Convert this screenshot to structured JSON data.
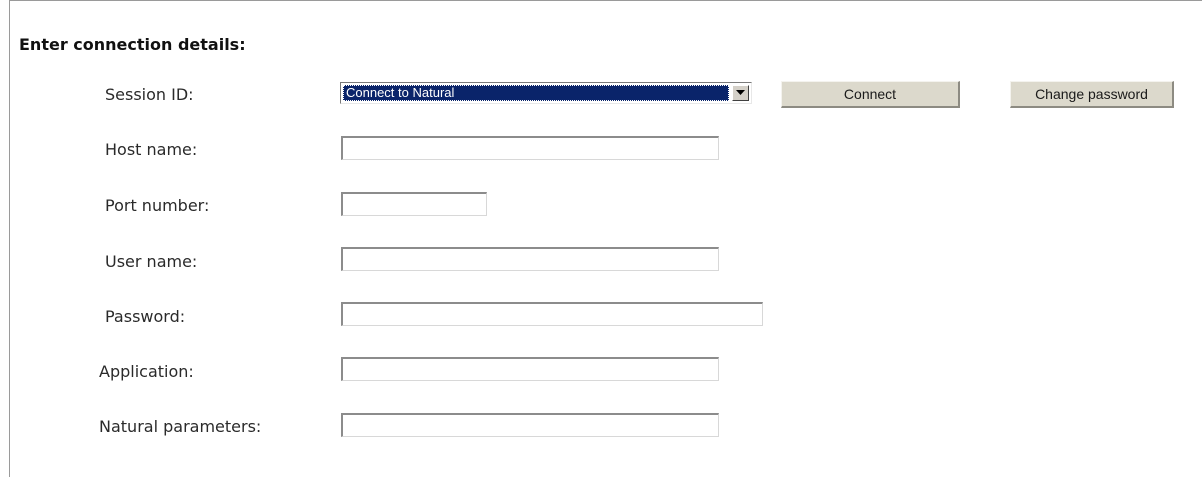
{
  "form": {
    "heading": "Enter connection details:",
    "session": {
      "label": "Session ID:",
      "selected": "Connect to Natural"
    },
    "buttons": {
      "connect": "Connect",
      "change_password": "Change password"
    },
    "fields": {
      "host_name": {
        "label": "Host name:",
        "value": ""
      },
      "port_number": {
        "label": "Port number:",
        "value": ""
      },
      "user_name": {
        "label": "User name:",
        "value": ""
      },
      "password": {
        "label": "Password:",
        "value": ""
      },
      "application": {
        "label": "Application:",
        "value": ""
      },
      "natural_parameters": {
        "label": "Natural parameters:",
        "value": ""
      }
    }
  },
  "colors": {
    "selection_bg": "#0a246a",
    "button_face": "#dcd9cc"
  },
  "icons": {
    "dropdown": "chevron-down-icon"
  }
}
